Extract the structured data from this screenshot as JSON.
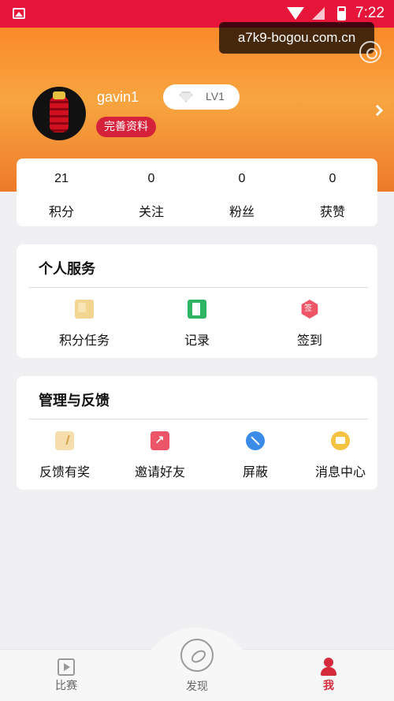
{
  "status_bar": {
    "time": "7:22",
    "icons": [
      "gallery-icon",
      "wifi-icon",
      "signal-icon",
      "battery-icon"
    ]
  },
  "watermark": {
    "text": "a7k9-bogou.com.cn"
  },
  "profile": {
    "username": "gavin1",
    "edit_label": "完善资料",
    "level": "LV1"
  },
  "stats": [
    {
      "value": "21",
      "label": "积分"
    },
    {
      "value": "0",
      "label": "关注"
    },
    {
      "value": "0",
      "label": "粉丝"
    },
    {
      "value": "0",
      "label": "获赞"
    }
  ],
  "personal_services": {
    "title": "个人服务",
    "items": [
      {
        "label": "积分任务",
        "icon": "points-task-icon"
      },
      {
        "label": "记录",
        "icon": "records-icon"
      },
      {
        "label": "签到",
        "icon": "sign-in-icon"
      }
    ]
  },
  "management": {
    "title": "管理与反馈",
    "items": [
      {
        "label": "反馈有奖",
        "icon": "feedback-icon"
      },
      {
        "label": "邀请好友",
        "icon": "invite-icon"
      },
      {
        "label": "屏蔽",
        "icon": "block-icon"
      },
      {
        "label": "消息中心",
        "icon": "message-icon"
      }
    ]
  },
  "bottom_nav": [
    {
      "label": "比赛",
      "icon": "matches-icon"
    },
    {
      "label": "发现",
      "icon": "discover-icon"
    },
    {
      "label": "我",
      "icon": "me-icon",
      "active": true
    }
  ],
  "colors": {
    "status_bar": "#e8153b",
    "header_orange": "#fb8a2a",
    "accent_red": "#d6213a"
  }
}
